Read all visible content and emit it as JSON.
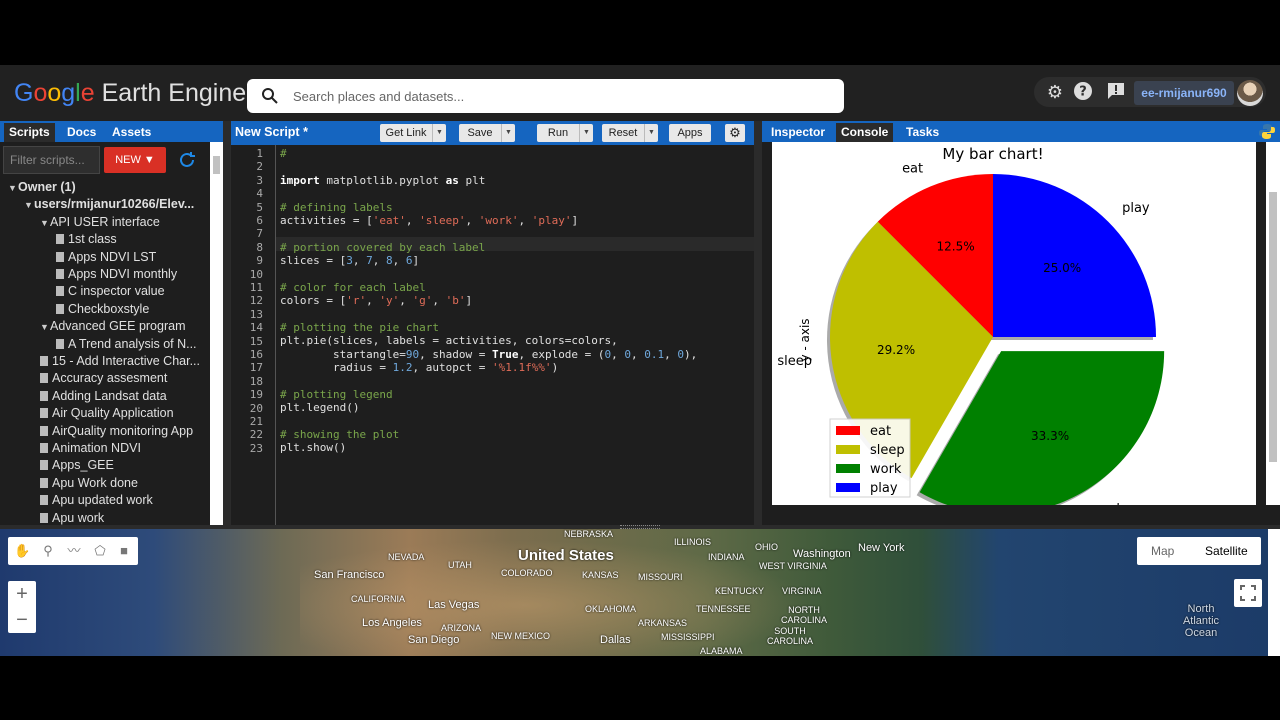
{
  "header": {
    "logo_g": [
      "G",
      "o",
      "o",
      "g",
      "l",
      "e"
    ],
    "logo_rest": " Earth Engine",
    "search_placeholder": "Search places and datasets...",
    "account": "ee-rmijanur690"
  },
  "left": {
    "tabs": [
      "Scripts",
      "Docs",
      "Assets"
    ],
    "filter_placeholder": "Filter scripts...",
    "new_label": "NEW",
    "tree": [
      {
        "label": "Owner (1)",
        "indent": 0,
        "type": "folder",
        "bold": true
      },
      {
        "label": "users/rmijanur10266/Elev...",
        "indent": 1,
        "type": "folder",
        "bold": true
      },
      {
        "label": "API USER interface",
        "indent": 2,
        "type": "folder"
      },
      {
        "label": "1st class",
        "indent": 3,
        "type": "file"
      },
      {
        "label": "Apps NDVI LST",
        "indent": 3,
        "type": "file"
      },
      {
        "label": "Apps NDVI monthly",
        "indent": 3,
        "type": "file"
      },
      {
        "label": "C inspector value",
        "indent": 3,
        "type": "file"
      },
      {
        "label": "Checkboxstyle",
        "indent": 3,
        "type": "file"
      },
      {
        "label": "Advanced GEE program",
        "indent": 2,
        "type": "folder"
      },
      {
        "label": "A Trend analysis of N...",
        "indent": 3,
        "type": "file"
      },
      {
        "label": "15 - Add Interactive Char...",
        "indent": 2,
        "type": "file"
      },
      {
        "label": "Accuracy assesment",
        "indent": 2,
        "type": "file"
      },
      {
        "label": "Adding Landsat data",
        "indent": 2,
        "type": "file"
      },
      {
        "label": "Air Quality Application",
        "indent": 2,
        "type": "file"
      },
      {
        "label": "AirQuality monitoring App",
        "indent": 2,
        "type": "file"
      },
      {
        "label": "Animation NDVI",
        "indent": 2,
        "type": "file"
      },
      {
        "label": "Apps_GEE",
        "indent": 2,
        "type": "file"
      },
      {
        "label": "Apu Work done",
        "indent": 2,
        "type": "file"
      },
      {
        "label": "Apu updated work",
        "indent": 2,
        "type": "file"
      },
      {
        "label": "Apu work",
        "indent": 2,
        "type": "file"
      }
    ]
  },
  "editor": {
    "title": "New Script *",
    "buttons": {
      "get_link": "Get Link",
      "save": "Save",
      "run": "Run",
      "reset": "Reset",
      "apps": "Apps"
    },
    "lines": [
      "1",
      "2",
      "3",
      "4",
      "5",
      "6",
      "7",
      "8",
      "9",
      "10",
      "11",
      "12",
      "13",
      "14",
      "15",
      "16",
      "17",
      "18",
      "19",
      "20",
      "21",
      "22",
      "23"
    ]
  },
  "right": {
    "tabs": [
      "Inspector",
      "Console",
      "Tasks"
    ]
  },
  "chart_data": {
    "type": "pie",
    "title": "My bar chart!",
    "ylabel": "y - axis",
    "categories": [
      "eat",
      "sleep",
      "work",
      "play"
    ],
    "values": [
      3,
      7,
      8,
      6
    ],
    "percent_labels": [
      "12.5%",
      "29.2%",
      "33.3%",
      "25.0%"
    ],
    "colors": [
      "#ff0000",
      "#bfbf00",
      "#008000",
      "#0000ff"
    ],
    "startangle": 90,
    "explode": [
      0,
      0,
      0.1,
      0
    ],
    "shadow": true,
    "legend": {
      "entries": [
        "eat",
        "sleep",
        "work",
        "play"
      ],
      "placement": "lower-left"
    }
  },
  "map": {
    "labels": {
      "united_states": "United States",
      "nevada": "NEVADA",
      "utah": "UTAH",
      "colorado": "COLORADO",
      "kansas": "KANSAS",
      "missouri": "MISSOURI",
      "san_francisco": "San Francisco",
      "california": "CALIFORNIA",
      "las_vegas": "Las Vegas",
      "los_angeles": "Los Angeles",
      "san_diego": "San Diego",
      "arizona": "ARIZONA",
      "new_mexico": "NEW MEXICO",
      "oklahoma": "OKLAHOMA",
      "arkansas": "ARKANSAS",
      "mississippi": "MISSISSIPPI",
      "alabama": "ALABAMA",
      "dallas": "Dallas",
      "tennessee": "TENNESSEE",
      "kentucky": "KENTUCKY",
      "virginia": "VIRGINIA",
      "west_virginia": "WEST VIRGINIA",
      "ohio": "OHIO",
      "indiana": "INDIANA",
      "illinois": "ILLINOIS",
      "nebraska": "NEBRASKA",
      "washington": "Washington",
      "new_york": "New York",
      "north_carolina": "NORTH CAROLINA",
      "south_carolina": "SOUTH CAROLINA",
      "ocean": "North Atlantic Ocean"
    },
    "map_type": {
      "map": "Map",
      "satellite": "Satellite"
    }
  }
}
